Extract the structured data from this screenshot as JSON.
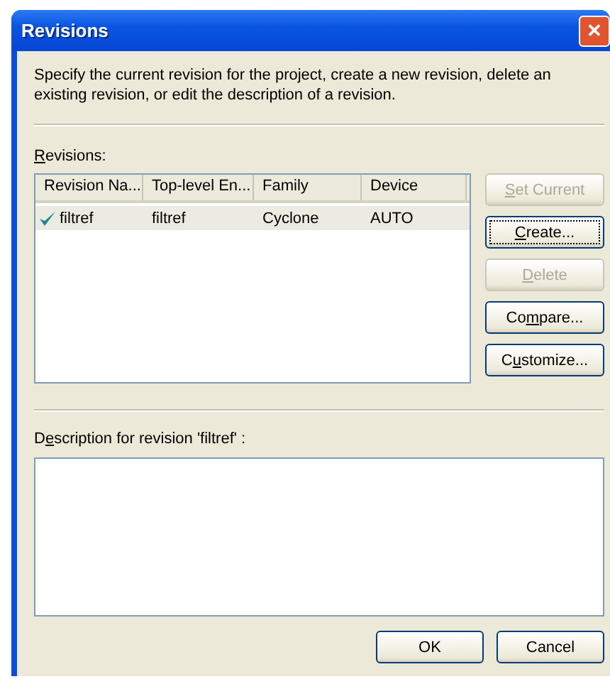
{
  "window": {
    "title": "Revisions",
    "close": "✕"
  },
  "intro": "Specify the current revision for the project, create a new revision, delete an existing revision, or edit the description of a revision.",
  "revisions_label": {
    "key": "R",
    "rest": "evisions:"
  },
  "table": {
    "columns": [
      "Revision Na...",
      "Top-level En...",
      "Family",
      "Device"
    ],
    "rows": [
      {
        "cells": [
          "filtref",
          "filtref",
          "Cyclone",
          "AUTO"
        ],
        "current": true,
        "selected": true
      }
    ]
  },
  "side_buttons": [
    {
      "key": "S",
      "rest": "et Current",
      "disabled": true,
      "focused": false
    },
    {
      "key": "C",
      "rest": "reate...",
      "disabled": false,
      "focused": true
    },
    {
      "key": "D",
      "rest": "elete",
      "disabled": true,
      "focused": false
    },
    {
      "lead": "Co",
      "key": "m",
      "rest": "pare...",
      "disabled": false,
      "focused": false
    },
    {
      "lead": "C",
      "key": "u",
      "rest": "stomize...",
      "disabled": false,
      "focused": false
    }
  ],
  "description_label": {
    "lead": "D",
    "key": "e",
    "rest": "scription for revision 'filtref' :"
  },
  "buttons": [
    "OK",
    "Cancel"
  ]
}
